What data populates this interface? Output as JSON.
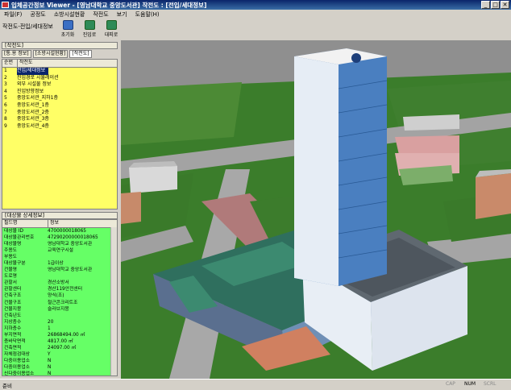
{
  "window": {
    "title": "입체공간정보 Viewer - [영남대학교 중앙도서관] 작전도 : [전입/세대정보]",
    "controls": [
      "_",
      "□",
      "✕"
    ]
  },
  "menubar": [
    "파일(F)",
    "공정도",
    "소방시설현황",
    "작전도",
    "보기",
    "도움말(H)"
  ],
  "toolbar": {
    "label": "작전도-전입/세대정보",
    "buttons": [
      {
        "label": "초기화",
        "icon": "reset-icon"
      },
      {
        "label": "진입로",
        "icon": "entry-route-icon"
      },
      {
        "label": "대피로",
        "icon": "evacuation-icon"
      }
    ]
  },
  "left_panel": {
    "title": "[작전도]",
    "subtabs": [
      "[통.용 정보]",
      "[소방시설현황]",
      "[작전도]"
    ],
    "list": {
      "columns": [
        "순번",
        "작전도"
      ],
      "items": [
        {
          "no": "1",
          "name": "전입/세대정보",
          "selected": true
        },
        {
          "no": "2",
          "name": "진입경로 시뮬레이션",
          "selected": false
        },
        {
          "no": "3",
          "name": "외부 시설물 정보",
          "selected": false
        },
        {
          "no": "4",
          "name": "진입방향정보",
          "selected": false
        },
        {
          "no": "5",
          "name": "중앙도서관_지하1층",
          "selected": false
        },
        {
          "no": "6",
          "name": "중앙도서관_1층",
          "selected": false
        },
        {
          "no": "7",
          "name": "중앙도서관_2층",
          "selected": false
        },
        {
          "no": "8",
          "name": "중앙도서관_3층",
          "selected": false
        },
        {
          "no": "9",
          "name": "중앙도서관_4층",
          "selected": false
        }
      ]
    },
    "props": {
      "title": "[대상물 상세정보]",
      "columns": [
        "필드명",
        "정보"
      ],
      "rows": [
        [
          "대상물 ID",
          "4700000018065"
        ],
        [
          "대상물관리번호",
          "47290200000018065"
        ],
        [
          "대상물명",
          "영남대학교 중앙도서관"
        ],
        [
          "주용도",
          "교육연구시설"
        ],
        [
          "부용도",
          ""
        ],
        [
          "대상물구분",
          "1급이상"
        ],
        [
          "건물명",
          "영남대학교 중앙도서관"
        ],
        [
          "도로명",
          ""
        ],
        [
          "관할서",
          "경산소방서"
        ],
        [
          "관할센터",
          "경산119안전센터"
        ],
        [
          "건축구조",
          "양식(조)"
        ],
        [
          "건물구조",
          "철근콘크리트조"
        ],
        [
          "건물지붕",
          "슬라브지붕"
        ],
        [
          "건축년도",
          ""
        ],
        [
          "지상층수",
          "20"
        ],
        [
          "지하층수",
          "1"
        ],
        [
          "부지면적",
          "26868494.00 ㎡"
        ],
        [
          "층바닥면적",
          "4817.00 ㎡"
        ],
        [
          "건축면적",
          "24097.00 ㎡"
        ],
        [
          "자체점검대상",
          "Y"
        ],
        [
          "다중이용업소",
          "N"
        ],
        [
          "다중이용업소",
          "N"
        ],
        [
          "신다중이용업소",
          "N"
        ]
      ]
    }
  },
  "statusbar": {
    "text": "준비",
    "indicators": [
      {
        "label": "CAP",
        "on": false
      },
      {
        "label": "NUM",
        "on": true
      },
      {
        "label": "SCRL",
        "on": false
      }
    ]
  },
  "colors": {
    "list_bg": "#ffff66",
    "props_bg": "#66ff66",
    "selection": "#0a246a",
    "grass": "#3a7a2a",
    "road": "#9a9a9a",
    "building_roof": "#2f6f5e"
  }
}
